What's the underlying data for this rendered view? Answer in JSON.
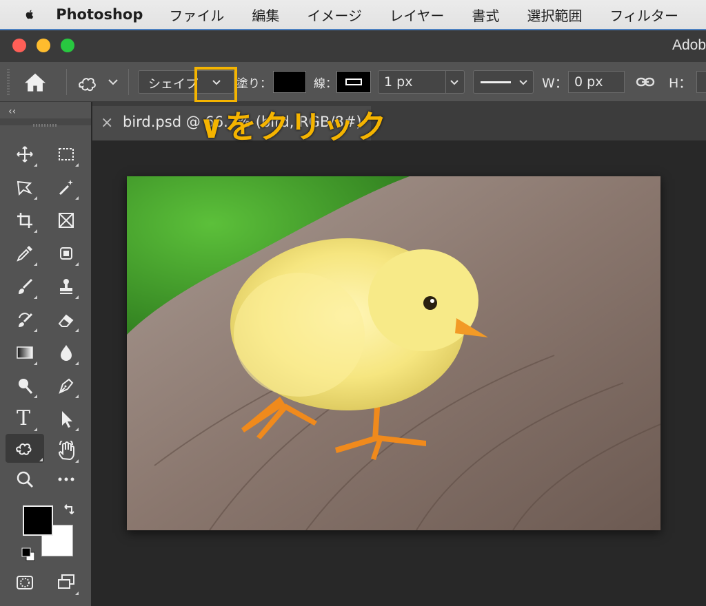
{
  "menubar": {
    "app_name": "Photoshop",
    "items": [
      "ファイル",
      "編集",
      "イメージ",
      "レイヤー",
      "書式",
      "選択範囲",
      "フィルター"
    ]
  },
  "window": {
    "title": "Adob"
  },
  "options_bar": {
    "mode_dropdown_label": "シェイプ",
    "fill_label": "塗り：",
    "fill_color": "#000000",
    "stroke_label": "線：",
    "stroke_width_value": "1 px",
    "width_label": "W：",
    "width_value": "0 px",
    "height_label": "H：",
    "height_value": ""
  },
  "toolbar_panel": {
    "collapse_label": "‹‹",
    "tools": [
      "move-tool",
      "rectangular-marquee-tool",
      "lasso-tool",
      "magic-wand-tool",
      "crop-tool",
      "frame-tool",
      "eyedropper-tool",
      "spot-healing-tool",
      "brush-tool",
      "clone-stamp-tool",
      "history-brush-tool",
      "eraser-tool",
      "gradient-tool",
      "blur-tool",
      "dodge-tool",
      "pen-tool",
      "type-tool",
      "path-selection-tool",
      "custom-shape-tool",
      "hand-tool",
      "zoom-tool",
      "more-tools"
    ],
    "type_tool_glyph": "T",
    "foreground_color": "#000000",
    "background_color": "#ffffff"
  },
  "document": {
    "tab_title": "bird.psd @ 66.7% (bird, RGB/8#)"
  },
  "annotation": {
    "text": "∨をクリック",
    "color": "#f5b400"
  }
}
